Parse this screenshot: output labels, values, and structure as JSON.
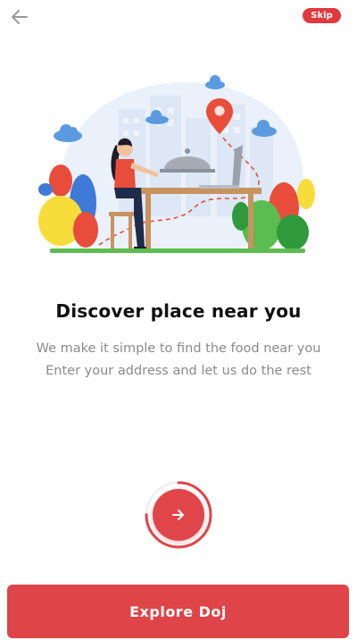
{
  "header": {
    "back_icon": "arrow-left-icon",
    "skip_label": "Skip",
    "accent": "#e0393e"
  },
  "onboarding": {
    "title": "Discover place near you",
    "description_line1": "We make it simple to find the food near you",
    "description_line2": "Enter your address and let us do the rest",
    "illustration": "person-dining-at-table-with-location-pin",
    "progress": 0.75
  },
  "actions": {
    "next_icon": "arrow-right-icon",
    "explore_label": "Explore Doj",
    "button_color": "#df4448"
  }
}
